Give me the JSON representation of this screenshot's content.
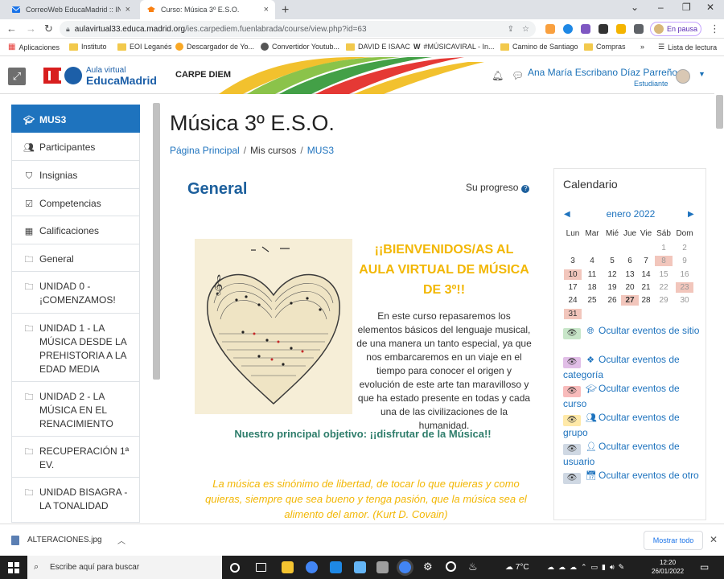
{
  "browser": {
    "tabs": [
      {
        "title": "CorreoWeb EducaMadrid :: INBOX",
        "active": false,
        "icon": "mail-icon"
      },
      {
        "title": "Curso: Música 3º E.S.O.",
        "active": true,
        "icon": "moodle-icon"
      }
    ],
    "new_tab": "+",
    "address": {
      "host": "aulavirtual33.educa.madrid.org",
      "path": "/ies.carpediem.fuenlabrada/course/view.php?id=63"
    },
    "profile_status": "En pausa",
    "bookmarks": [
      "Aplicaciones",
      "Instituto",
      "EOI Leganés",
      "Descargador de Yo...",
      "Convertidor Youtub...",
      "DAVID E ISAAC",
      "#MÚSICAVIRAL - In...",
      "Camino de Santiago",
      "Compras",
      "»",
      "Lista de lectura"
    ]
  },
  "site": {
    "logo_line1": "Aula virtual",
    "logo_line2": "EducaMadrid",
    "name": "CARPE DIEM",
    "user_name": "Ana María Escribano Díaz Parreño",
    "user_role": "Estudiante"
  },
  "nav": [
    {
      "label": "MUS3",
      "icon": "graduation-cap-icon",
      "selected": true
    },
    {
      "label": "Participantes",
      "icon": "users-icon"
    },
    {
      "label": "Insignias",
      "icon": "shield-icon"
    },
    {
      "label": "Competencias",
      "icon": "check-square-icon"
    },
    {
      "label": "Calificaciones",
      "icon": "table-icon"
    },
    {
      "label": "General",
      "icon": "folder-icon"
    },
    {
      "label": "UNIDAD 0 - ¡COMENZAMOS!",
      "icon": "folder-icon"
    },
    {
      "label": "UNIDAD 1 - LA MÚSICA DESDE LA PREHISTORIA A LA EDAD MEDIA",
      "icon": "folder-icon"
    },
    {
      "label": "UNIDAD 2 - LA MÚSICA EN EL RENACIMIENTO",
      "icon": "folder-icon"
    },
    {
      "label": "RECUPERACIÓN 1ª EV.",
      "icon": "folder-icon"
    },
    {
      "label": "UNIDAD BISAGRA - LA TONALIDAD",
      "icon": "folder-icon"
    }
  ],
  "main": {
    "title": "Música 3º E.S.O.",
    "breadcrumb": [
      "Página Principal",
      "Mis cursos",
      "MUS3"
    ],
    "section_title": "General",
    "progress_label": "Su progreso",
    "welcome": "¡¡BIENVENIDOS/AS AL AULA VIRTUAL DE MÚSICA DE 3º!!",
    "intro": "En este curso repasaremos los elementos básicos del lenguaje musical, de una manera un tanto especial, ya que nos embarcaremos en un viaje en el tiempo para conocer el origen y evolución de este arte tan maravilloso y que ha estado presente en todas y cada una de las civilizaciones de la humanidad.",
    "objective": "Nuestro principal objetivo: ¡¡disfrutar de la Música!!",
    "quote": "La música es sinónimo de libertad, de tocar lo que quieras y como quieras, siempre que sea bueno y tenga pasión, que la música sea el alimento del amor. (Kurt D. Covain)"
  },
  "calendar": {
    "title": "Calendario",
    "month": "enero 2022",
    "weekdays": [
      "Lun",
      "Mar",
      "Mié",
      "Jue",
      "Vie",
      "Sáb",
      "Dom"
    ],
    "weeks": [
      [
        "",
        "",
        "",
        "",
        "",
        "1",
        "2"
      ],
      [
        "3",
        "4",
        "5",
        "6",
        "7",
        "8",
        "9"
      ],
      [
        "10",
        "11",
        "12",
        "13",
        "14",
        "15",
        "16"
      ],
      [
        "17",
        "18",
        "19",
        "20",
        "21",
        "22",
        "23"
      ],
      [
        "24",
        "25",
        "26",
        "27",
        "28",
        "29",
        "30"
      ],
      [
        "31",
        "",
        "",
        "",
        "",
        "",
        ""
      ]
    ],
    "highlighted": [
      "8",
      "10",
      "23",
      "27",
      "31"
    ],
    "today": "27",
    "events": [
      {
        "label": "Ocultar eventos de sitio",
        "color": "#c8e6c9",
        "icon": "globe-icon"
      },
      {
        "label": "Ocultar eventos de categoría",
        "color": "#e1bee7",
        "icon": "cubes-icon"
      },
      {
        "label": "Ocultar eventos de curso",
        "color": "#f8bbbb",
        "icon": "graduation-cap-icon"
      },
      {
        "label": "Ocultar eventos de grupo",
        "color": "#ffe9a8",
        "icon": "users-icon"
      },
      {
        "label": "Ocultar eventos de usuario",
        "color": "#cfd8e3",
        "icon": "user-icon"
      },
      {
        "label": "Ocultar eventos de otro",
        "color": "#cfd8e3",
        "icon": "calendar-icon"
      }
    ]
  },
  "downloads": {
    "file": "ALTERACIONES.jpg",
    "show_all": "Mostrar todo"
  },
  "taskbar": {
    "search_placeholder": "Escribe aquí para buscar",
    "weather": "7°C",
    "time": "12:20",
    "date": "26/01/2022"
  },
  "colors": {
    "primary": "#1e73be",
    "accent_yellow": "#f2b705",
    "objective_green": "#2e7d6b",
    "highlight": "#f2c6bc"
  }
}
